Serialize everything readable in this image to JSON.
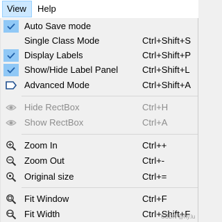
{
  "menubar": {
    "items": [
      {
        "label": "View"
      },
      {
        "label": "Help"
      }
    ]
  },
  "menu": {
    "items": [
      {
        "label": "Auto Save mode",
        "shortcut": "",
        "checked": true
      },
      {
        "label": "Single Class Mode",
        "shortcut": "Ctrl+Shift+S"
      },
      {
        "label": "Display Labels",
        "shortcut": "Ctrl+Shift+P",
        "checked": true
      },
      {
        "label": "Show/Hide Label Panel",
        "shortcut": "Ctrl+Shift+L",
        "checked": true
      },
      {
        "label": "Advanced Mode",
        "shortcut": "Ctrl+Shift+A",
        "icon": "label-tag-icon"
      },
      {
        "label": "Hide RectBox",
        "shortcut": "Ctrl+H",
        "disabled": true,
        "icon": "eye-icon"
      },
      {
        "label": "Show RectBox",
        "shortcut": "Ctrl+A",
        "disabled": true,
        "icon": "eye-icon"
      },
      {
        "label": "Zoom In",
        "shortcut": "Ctrl++",
        "icon": "zoom-in-icon"
      },
      {
        "label": "Zoom Out",
        "shortcut": "Ctrl+-",
        "icon": "zoom-out-icon"
      },
      {
        "label": "Original size",
        "shortcut": "Ctrl+=",
        "icon": "zoom-original-icon"
      },
      {
        "label": "Fit Window",
        "shortcut": "Ctrl+F",
        "icon": "fit-window-icon"
      },
      {
        "label": "Fit Width",
        "shortcut": "Ctrl+Shift+F",
        "icon": "fit-width-icon"
      }
    ]
  },
  "watermark": "CSDN @hy.lu",
  "colors": {
    "check_bg": "#90c8f6",
    "check_mark": "#1f5fa8",
    "menubar_active": "#cce8ff"
  }
}
